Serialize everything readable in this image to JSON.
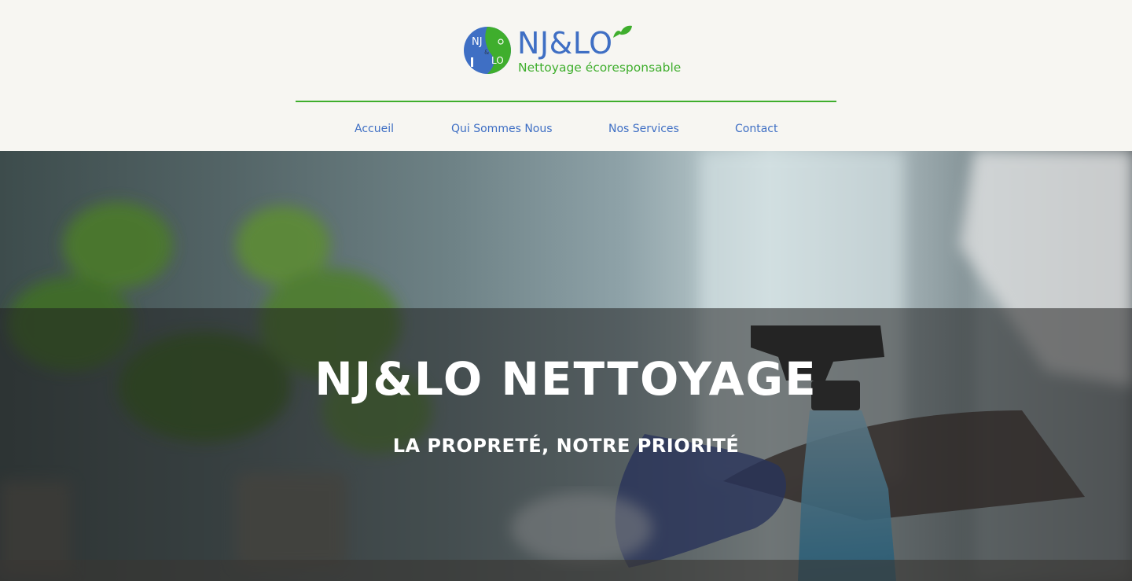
{
  "header": {
    "logo": {
      "mark_letters_top": "NJ",
      "mark_ampersand": "&",
      "mark_letters_bottom": "LO",
      "brand": "NJ&LO",
      "tagline": "Nettoyage écoresponsable"
    },
    "nav": [
      {
        "label": "Accueil"
      },
      {
        "label": "Qui Sommes Nous"
      },
      {
        "label": "Nos Services"
      },
      {
        "label": "Contact"
      }
    ]
  },
  "hero": {
    "title": "NJ&LO NETTOYAGE",
    "subtitle": "LA PROPRETÉ, NOTRE PRIORITÉ"
  },
  "colors": {
    "background": "#f7f6f2",
    "brand_blue": "#3f6fc4",
    "brand_green": "#3fae2d",
    "hero_text": "#ffffff"
  }
}
